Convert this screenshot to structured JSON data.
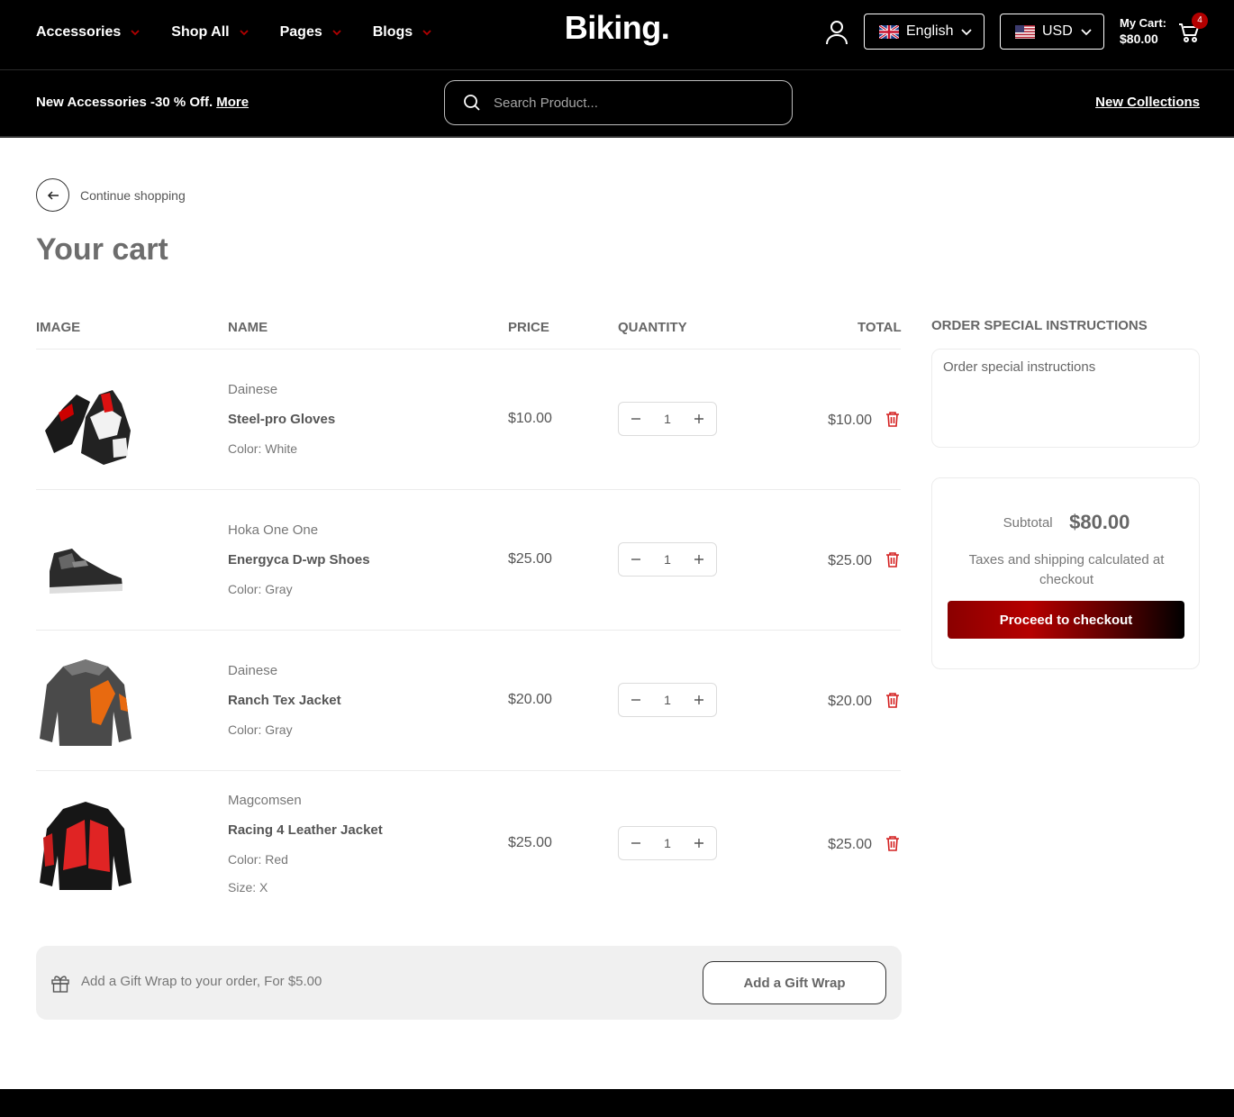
{
  "header": {
    "nav": [
      {
        "label": "Accessories"
      },
      {
        "label": "Shop All"
      },
      {
        "label": "Pages"
      },
      {
        "label": "Blogs"
      }
    ],
    "logo": "Biking.",
    "language": "English",
    "currency": "USD",
    "cart_label": "My Cart:",
    "cart_amount": "$80.00",
    "cart_count": "4"
  },
  "subbar": {
    "promo": "New Accessories -30 % Off.",
    "promo_link": "More",
    "search_placeholder": "Search Product...",
    "new_collections": "New Collections"
  },
  "page": {
    "back_label": "Continue shopping",
    "title": "Your cart"
  },
  "table": {
    "headers": {
      "image": "IMAGE",
      "name": "NAME",
      "price": "PRICE",
      "quantity": "QUANTITY",
      "total": "TOTAL"
    },
    "items": [
      {
        "brand": "Dainese",
        "name": "Steel-pro Gloves",
        "attrs": [
          {
            "label": "Color:",
            "value": "White"
          }
        ],
        "price": "$10.00",
        "qty": "1",
        "total": "$10.00"
      },
      {
        "brand": "Hoka One One",
        "name": "Energyca D-wp Shoes",
        "attrs": [
          {
            "label": "Color:",
            "value": "Gray"
          }
        ],
        "price": "$25.00",
        "qty": "1",
        "total": "$25.00"
      },
      {
        "brand": "Dainese",
        "name": "Ranch Tex Jacket",
        "attrs": [
          {
            "label": "Color:",
            "value": "Gray"
          }
        ],
        "price": "$20.00",
        "qty": "1",
        "total": "$20.00"
      },
      {
        "brand": "Magcomsen",
        "name": "Racing 4 Leather Jacket",
        "attrs": [
          {
            "label": "Color:",
            "value": "Red"
          },
          {
            "label": "Size:",
            "value": "X"
          }
        ],
        "price": "$25.00",
        "qty": "1",
        "total": "$25.00"
      }
    ]
  },
  "gift": {
    "text": "Add a Gift Wrap to your order, For $5.00",
    "button": "Add a Gift Wrap"
  },
  "sidebar": {
    "instructions_title": "ORDER SPECIAL INSTRUCTIONS",
    "instructions_placeholder": "Order special instructions",
    "subtotal_label": "Subtotal",
    "subtotal": "$80.00",
    "taxes_note": "Taxes and shipping calculated at checkout",
    "checkout_button": "Proceed to checkout"
  },
  "colors": {
    "accent": "#b30000",
    "header_bg": "#000000"
  }
}
